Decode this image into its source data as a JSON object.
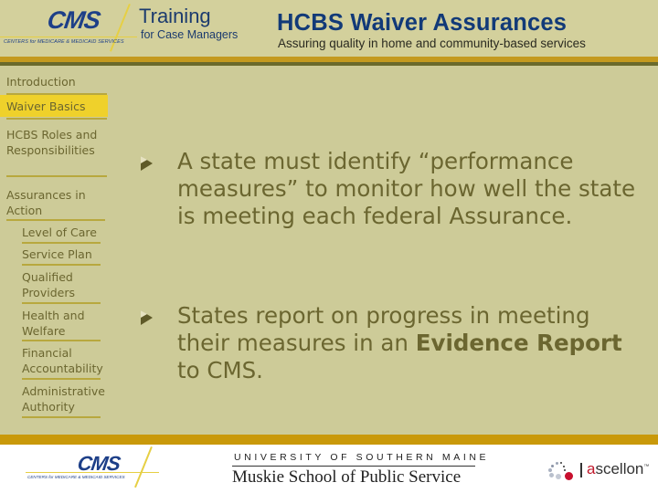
{
  "header": {
    "cms_logo": {
      "wordmark": "CMS",
      "tagline": "CENTERS for MEDICARE & MEDICAID SERVICES"
    },
    "training_title": "Training",
    "training_subtitle": "for Case Managers",
    "course_title": "HCBS Waiver Assurances",
    "course_subtitle": "Assuring quality in home and community-based services"
  },
  "sidebar": {
    "items": [
      {
        "label": "Introduction",
        "level": 0,
        "active": false
      },
      {
        "label": "Waiver Basics",
        "level": 0,
        "active": true
      },
      {
        "label": "HCBS Roles and Responsibilities",
        "level": 0,
        "active": false
      },
      {
        "label": "Assurances in Action",
        "level": 0,
        "active": false
      },
      {
        "label": "Level of Care",
        "level": 1,
        "active": false
      },
      {
        "label": "Service Plan",
        "level": 1,
        "active": false
      },
      {
        "label": "Qualified Providers",
        "level": 1,
        "active": false
      },
      {
        "label": "Health and Welfare",
        "level": 1,
        "active": false
      },
      {
        "label": "Financial Accountability",
        "level": 1,
        "active": false
      },
      {
        "label": "Administrative Authority",
        "level": 1,
        "active": false
      }
    ]
  },
  "main": {
    "bullets": [
      {
        "text": "A state must identify “performance measures” to monitor how well the state is meeting each federal Assurance."
      },
      {
        "text_before": "States report on progress in meeting their measures in an ",
        "bold": "Evidence Report",
        "text_after": " to CMS."
      }
    ]
  },
  "footer": {
    "cms_logo": {
      "wordmark": "CMS",
      "tagline": "CENTERS for MEDICARE & MEDICAID SERVICES"
    },
    "usm_line1": "UNIVERSITY OF SOUTHERN MAINE",
    "usm_line2": "Muskie School of Public Service",
    "ascellon_first": "a",
    "ascellon_rest": "scellon",
    "ascellon_tm": "™"
  },
  "colors": {
    "background": "#cdcb98",
    "header_bg": "#d3d09c",
    "gold_stripe": "#c49a1f",
    "olive_stripe": "#6a6a2c",
    "active_highlight": "#efd12b",
    "text": "#6b6630",
    "cms_blue": "#1d3f88",
    "course_title_blue": "#123a78"
  }
}
